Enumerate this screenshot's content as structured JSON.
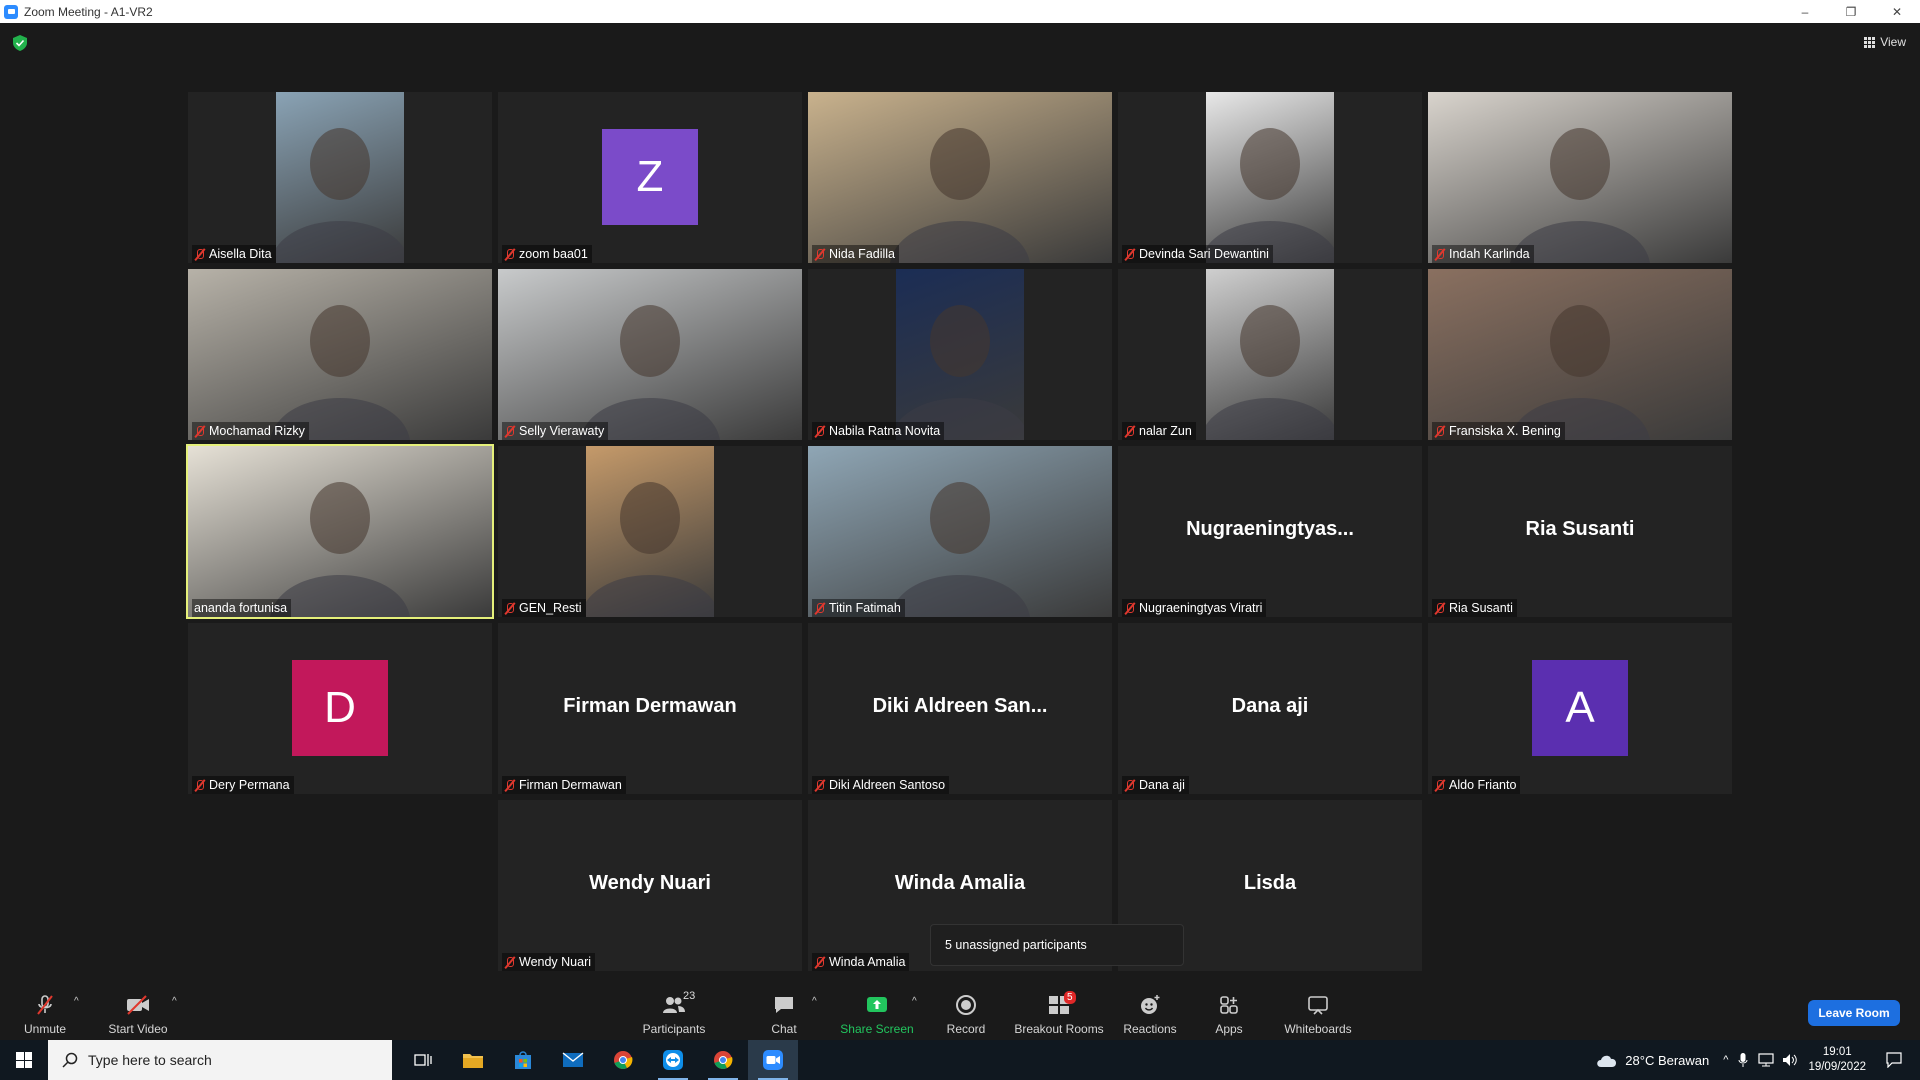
{
  "window": {
    "title": "Zoom Meeting - A1-VR2",
    "controls": [
      "–",
      "❐",
      "✕"
    ]
  },
  "topbar": {
    "view_label": "View"
  },
  "tiles": [
    {
      "label": "Aisella Dita",
      "kind": "video",
      "bg": "#8aa3b5",
      "narrow": true
    },
    {
      "label": "zoom baa01",
      "kind": "avatar",
      "letter": "Z",
      "color": "#7b4bc9"
    },
    {
      "label": "Nida Fadilla",
      "kind": "video",
      "bg": "#c9b28d"
    },
    {
      "label": "Devinda Sari Dewantini",
      "kind": "video",
      "bg": "#e8e8e8",
      "narrow": true
    },
    {
      "label": "Indah Karlinda",
      "kind": "video",
      "bg": "#d9d4cd"
    },
    {
      "label": "Mochamad Rizky",
      "kind": "video",
      "bg": "#b7b2a8"
    },
    {
      "label": "Selly Vierawaty",
      "kind": "video",
      "bg": "#c8cacb"
    },
    {
      "label": "Nabila Ratna Novita",
      "kind": "video",
      "bg": "#1b2d55",
      "narrow": true
    },
    {
      "label": "nalar Zun",
      "kind": "video",
      "bg": "#cfcfcf",
      "narrow": true
    },
    {
      "label": "Fransiska X. Bening",
      "kind": "video",
      "bg": "#8a7060"
    },
    {
      "label": "ananda fortunisa",
      "kind": "video",
      "bg": "#e6e1d6",
      "active": true,
      "unmuted": true
    },
    {
      "label": "GEN_Resti",
      "kind": "video",
      "bg": "#c59a6a",
      "narrow": true
    },
    {
      "label": "Titin Fatimah",
      "kind": "video",
      "bg": "#8fa6b5"
    },
    {
      "label": "Nugraeningtyas Viratri",
      "kind": "name",
      "display": "Nugraeningtyas..."
    },
    {
      "label": "Ria Susanti",
      "kind": "name",
      "display": "Ria Susanti"
    },
    {
      "label": "Dery Permana",
      "kind": "avatar",
      "letter": "D",
      "color": "#c2185b"
    },
    {
      "label": "Firman Dermawan",
      "kind": "name",
      "display": "Firman Dermawan"
    },
    {
      "label": "Diki Aldreen Santoso",
      "kind": "name",
      "display": "Diki Aldreen San..."
    },
    {
      "label": "Dana aji",
      "kind": "name",
      "display": "Dana aji"
    },
    {
      "label": "Aldo Frianto",
      "kind": "avatar",
      "letter": "A",
      "color": "#5b2fb0"
    },
    {
      "label": "Wendy Nuari",
      "kind": "name",
      "display": "Wendy Nuari"
    },
    {
      "label": "Winda Amalia",
      "kind": "name",
      "display": "Winda Amalia"
    },
    {
      "label": "Lisda",
      "kind": "name",
      "display": "Lisda",
      "nolabel": true
    }
  ],
  "popup": {
    "text": "5 unassigned participants"
  },
  "toolbar": {
    "unmute": "Unmute",
    "start_video": "Start Video",
    "participants": "Participants",
    "participants_count": "23",
    "chat": "Chat",
    "share_screen": "Share Screen",
    "record": "Record",
    "breakout_rooms": "Breakout Rooms",
    "breakout_badge": "5",
    "reactions": "Reactions",
    "apps": "Apps",
    "whiteboards": "Whiteboards",
    "leave": "Leave Room"
  },
  "taskbar": {
    "search_placeholder": "Type here to search",
    "weather": "28°C  Berawan",
    "time": "19:01",
    "date": "19/09/2022"
  },
  "colors": {
    "share_green": "#22c55e",
    "leave_blue": "#1d6fe0",
    "mute_red": "#e0382e",
    "active_border": "#e5f07a"
  }
}
